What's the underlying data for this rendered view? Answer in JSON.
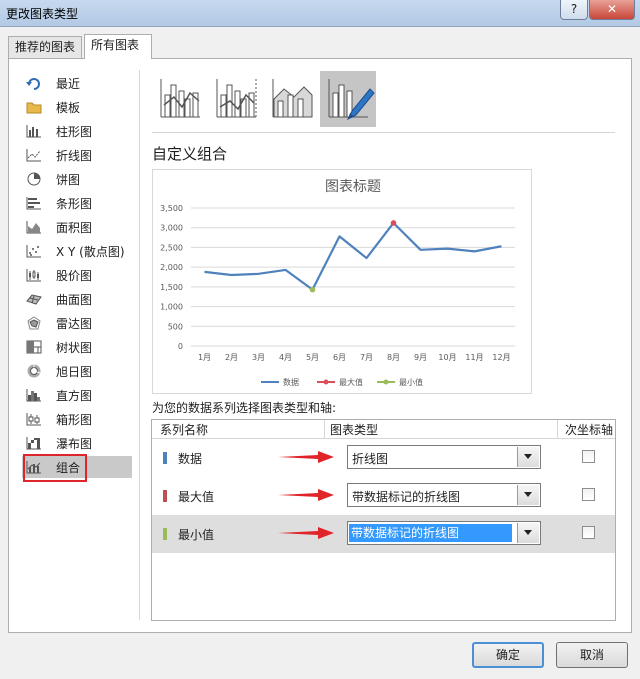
{
  "window": {
    "title": "更改图表类型",
    "help_label": "?",
    "close_label": "✕"
  },
  "tabs": [
    {
      "label": "推荐的图表",
      "active": false
    },
    {
      "label": "所有图表",
      "active": true
    }
  ],
  "sidebar": {
    "items": [
      {
        "label": "最近",
        "icon": "recent-icon"
      },
      {
        "label": "模板",
        "icon": "folder-icon"
      },
      {
        "label": "柱形图",
        "icon": "column-chart-icon"
      },
      {
        "label": "折线图",
        "icon": "line-chart-icon"
      },
      {
        "label": "饼图",
        "icon": "pie-chart-icon"
      },
      {
        "label": "条形图",
        "icon": "bar-chart-icon"
      },
      {
        "label": "面积图",
        "icon": "area-chart-icon"
      },
      {
        "label": "X Y (散点图)",
        "icon": "scatter-chart-icon"
      },
      {
        "label": "股价图",
        "icon": "stock-chart-icon"
      },
      {
        "label": "曲面图",
        "icon": "surface-chart-icon"
      },
      {
        "label": "雷达图",
        "icon": "radar-chart-icon"
      },
      {
        "label": "树状图",
        "icon": "treemap-chart-icon"
      },
      {
        "label": "旭日图",
        "icon": "sunburst-chart-icon"
      },
      {
        "label": "直方图",
        "icon": "histogram-chart-icon"
      },
      {
        "label": "箱形图",
        "icon": "box-whisker-chart-icon"
      },
      {
        "label": "瀑布图",
        "icon": "waterfall-chart-icon"
      },
      {
        "label": "组合",
        "icon": "combo-chart-icon",
        "selected": true
      }
    ]
  },
  "subtypes": [
    {
      "icon": "clustered-column-line-icon"
    },
    {
      "icon": "clustered-column-line-secondary-axis-icon"
    },
    {
      "icon": "stacked-area-clustered-column-icon"
    },
    {
      "icon": "custom-combination-icon",
      "active": true
    }
  ],
  "section_heading": "自定义组合",
  "chart_data": {
    "type": "line",
    "title": "图表标题",
    "categories": [
      "1月",
      "2月",
      "3月",
      "4月",
      "5月",
      "6月",
      "7月",
      "8月",
      "9月",
      "10月",
      "11月",
      "12月"
    ],
    "ylim": [
      0,
      3500
    ],
    "yticks": [
      "0",
      "500",
      "1,000",
      "1,500",
      "2,000",
      "2,500",
      "3,000",
      "3,500"
    ],
    "grid": true,
    "legend_position": "bottom",
    "series": [
      {
        "name": "数据",
        "values": [
          1880,
          1800,
          1830,
          1930,
          1430,
          2780,
          2230,
          3120,
          2440,
          2470,
          2400,
          2530
        ],
        "color": "#4f81bd"
      },
      {
        "name": "最大值",
        "values": [
          null,
          null,
          null,
          null,
          null,
          null,
          null,
          3120,
          null,
          null,
          null,
          null
        ],
        "color": "#d9505a"
      },
      {
        "name": "最小值",
        "values": [
          null,
          null,
          null,
          null,
          1430,
          null,
          null,
          null,
          null,
          null,
          null,
          null
        ],
        "color": "#9bbb59"
      }
    ]
  },
  "series_config": {
    "instruction": "为您的数据系列选择图表类型和轴:",
    "headers": {
      "name": "系列名称",
      "type": "图表类型",
      "axis": "次坐标轴"
    },
    "rows": [
      {
        "name": "数据",
        "chart_type": "折线图",
        "secondary_axis": false,
        "color": "#4f81bd",
        "selected": false
      },
      {
        "name": "最大值",
        "chart_type": "带数据标记的折线图",
        "secondary_axis": false,
        "color": "#c0504d",
        "selected": false
      },
      {
        "name": "最小值",
        "chart_type": "带数据标记的折线图",
        "secondary_axis": false,
        "color": "#9bbb59",
        "selected": true
      }
    ]
  },
  "buttons": {
    "ok": "确定",
    "cancel": "取消"
  }
}
